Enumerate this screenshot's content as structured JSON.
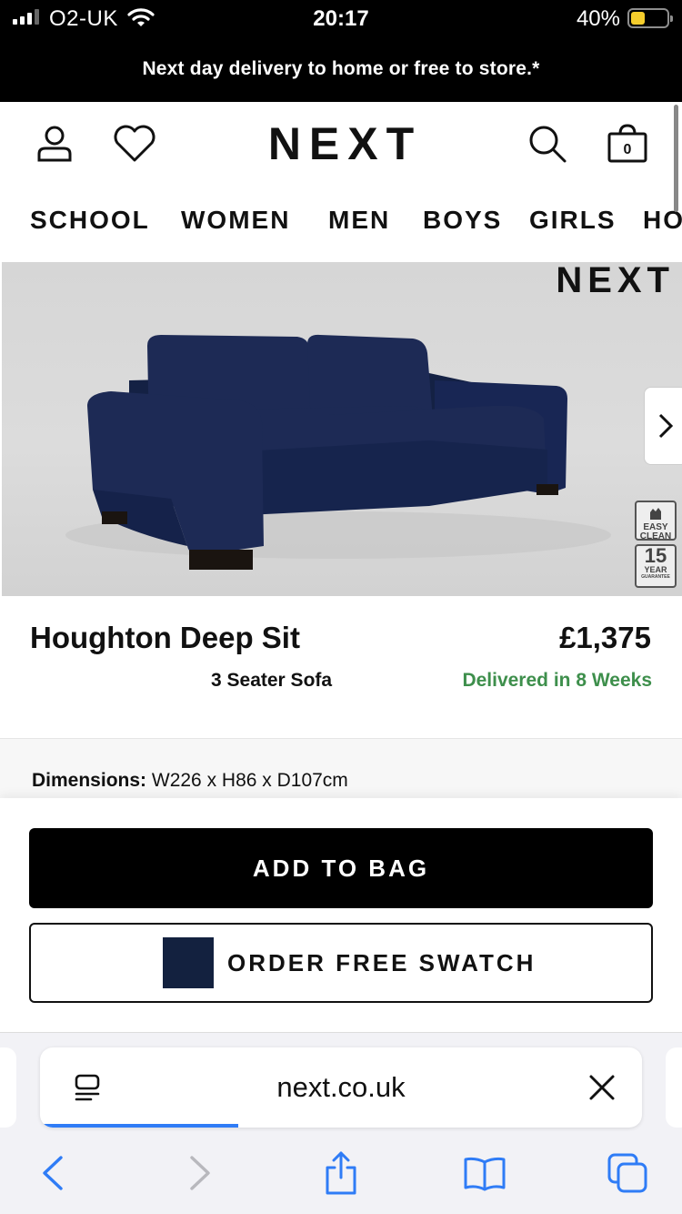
{
  "status_bar": {
    "carrier": "O2-UK",
    "time": "20:17",
    "battery_percent": "40%",
    "battery_level": 0.4,
    "battery_color": "#f5cd2c"
  },
  "promo": {
    "text": "Next day delivery to home or free to store.*"
  },
  "header": {
    "logo": "NEXT",
    "bag_count": "0",
    "icons": [
      "account-icon",
      "wishlist-heart-icon",
      "search-icon",
      "bag-icon"
    ]
  },
  "nav": {
    "categories": [
      "SCHOOL",
      "WOMEN",
      "MEN",
      "BOYS",
      "GIRLS",
      "HO"
    ]
  },
  "gallery": {
    "watermark": "NEXT",
    "badges": {
      "easy_clean": [
        "EASY",
        "CLEAN"
      ],
      "guarantee_number": "15",
      "guarantee_unit": "YEAR",
      "guarantee_label": "GUARANTEE"
    },
    "sofa_color": "#1d2a55"
  },
  "product": {
    "name": "Houghton Deep Sit",
    "type": "3 Seater Sofa",
    "price": "£1,375",
    "delivery": "Delivered in 8 Weeks",
    "delivery_color": "#3e8f4c"
  },
  "dimensions": {
    "label": "Dimensions:",
    "value": "W226 x H86 x D107cm"
  },
  "actions": {
    "add_to_bag": "ADD TO BAG",
    "order_swatch": "ORDER FREE SWATCH",
    "swatch_color": "#13213f"
  },
  "browser": {
    "url": "next.co.uk",
    "load_progress": 0.33,
    "accent": "#2f7cf6",
    "toolbar": [
      "back-icon",
      "forward-icon",
      "share-icon",
      "bookmarks-icon",
      "tabs-icon"
    ]
  }
}
